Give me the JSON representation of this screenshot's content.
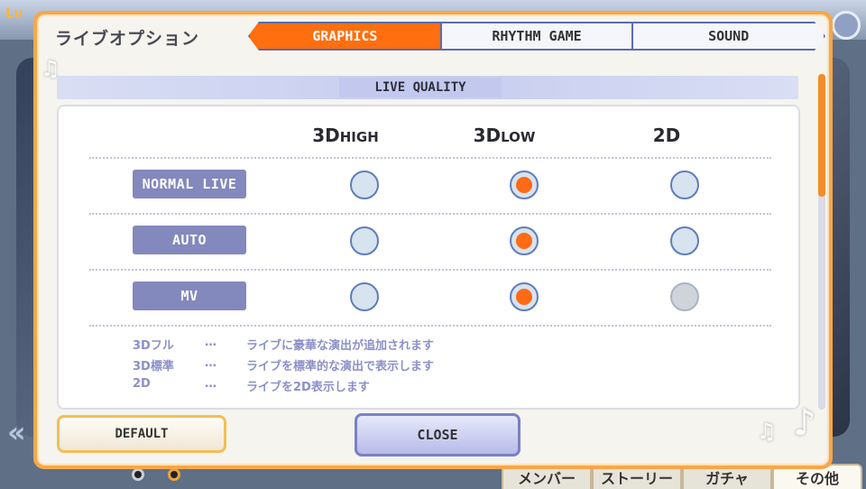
{
  "background": {
    "level_label": "Lv",
    "bottom_nav": [
      "メンバー",
      "ストーリー",
      "ガチャ",
      "その他"
    ]
  },
  "dialog": {
    "title": "ライブオプション",
    "tabs": [
      {
        "label": "GRAPHICS",
        "active": true
      },
      {
        "label": "RHYTHM GAME",
        "active": false
      },
      {
        "label": "SOUND",
        "active": false
      }
    ],
    "section_label": "LIVE QUALITY",
    "columns": [
      {
        "main": "3D",
        "sub": "HIGH"
      },
      {
        "main": "3D",
        "sub": "LOW"
      },
      {
        "main": "2D",
        "sub": ""
      }
    ],
    "rows": [
      {
        "label": "NORMAL LIVE",
        "selected": 1,
        "disabled": []
      },
      {
        "label": "AUTO",
        "selected": 1,
        "disabled": []
      },
      {
        "label": "MV",
        "selected": 1,
        "disabled": [
          2
        ]
      }
    ],
    "descriptions": [
      {
        "term": "3Dフル",
        "sep": "…",
        "text": "ライブに豪華な演出が追加されます"
      },
      {
        "term": "3D標準",
        "sep": "…",
        "text": "ライブを標準的な演出で表示します"
      },
      {
        "term": "2D",
        "sep": "…",
        "text": "ライブを2D表示します"
      }
    ],
    "buttons": {
      "default": "DEFAULT",
      "close": "CLOSE"
    }
  }
}
